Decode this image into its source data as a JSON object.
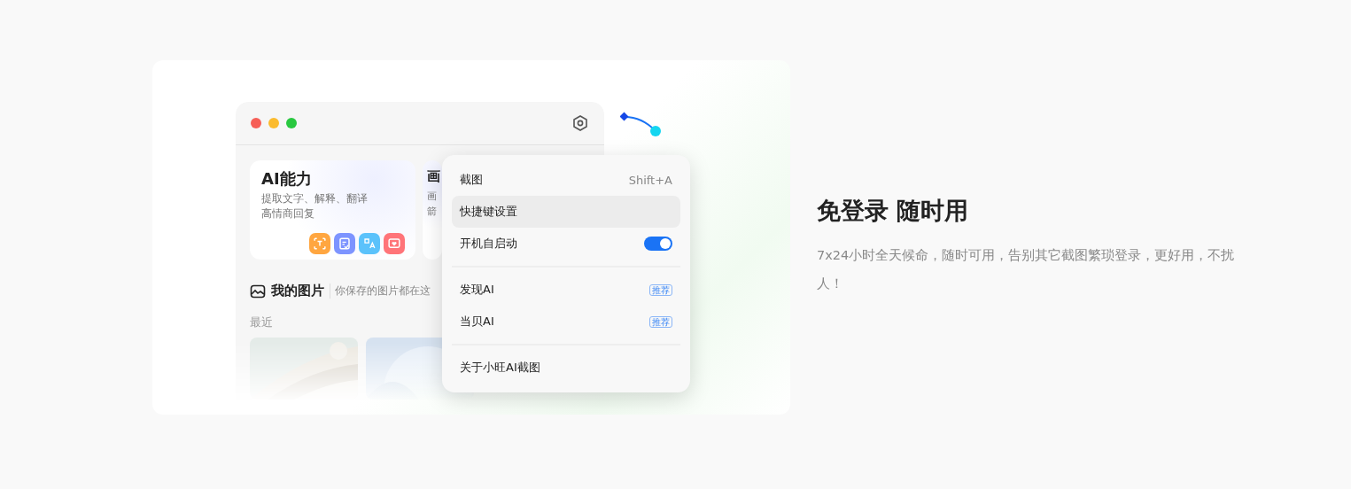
{
  "app_window": {
    "cards": [
      {
        "title": "AI能力",
        "lines": [
          "提取文字、解释、翻译",
          "高情商回复"
        ],
        "tools": [
          {
            "color": "#ffa640"
          },
          {
            "color": "#7d94ff"
          },
          {
            "color": "#5bc2fb"
          },
          {
            "color": "#ff7479"
          }
        ]
      },
      {
        "title": "画",
        "lines": [
          "画",
          "箭"
        ]
      }
    ],
    "gallery": {
      "title": "我的图片",
      "subtitle": "你保存的图片都在这",
      "section": "最近"
    }
  },
  "menu": {
    "groups": [
      [
        {
          "kind": "shortcut",
          "label": "截图",
          "shortcut": "Shift+A",
          "selected": false
        },
        {
          "kind": "plain",
          "label": "快捷键设置",
          "selected": true
        },
        {
          "kind": "toggle",
          "label": "开机自启动",
          "on": true,
          "selected": false
        }
      ],
      [
        {
          "kind": "badge",
          "label": "发现AI",
          "badge": "推荐",
          "selected": false
        },
        {
          "kind": "badge",
          "label": "当贝AI",
          "badge": "推荐",
          "selected": false
        }
      ],
      [
        {
          "kind": "plain",
          "label": "关于小旺AI截图",
          "selected": false
        }
      ]
    ]
  },
  "feature": {
    "title": "免登录 随时用",
    "description": "7x24小时全天候命，随时可用，告别其它截图繁琐登录，更好用，不扰人！"
  }
}
